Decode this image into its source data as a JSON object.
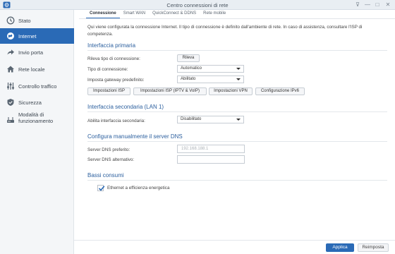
{
  "window": {
    "title": "Centro connessioni di rete"
  },
  "sidebar": {
    "items": [
      {
        "label": "Stato"
      },
      {
        "label": "Internet"
      },
      {
        "label": "Invio porta"
      },
      {
        "label": "Rete locale"
      },
      {
        "label": "Controllo traffico"
      },
      {
        "label": "Sicurezza"
      },
      {
        "label_line1": "Modalità di",
        "label_line2": "funzionamento"
      }
    ]
  },
  "tabs": [
    "Connessione",
    "Smart WAN",
    "QuickConnect & DDNS",
    "Rete mobile"
  ],
  "intro": "Qui viene configurata la connessione Internet. Il tipo di connessione è definito dall'ambiente di rete. In caso di assistenza, consultare l'ISP di competenza.",
  "primary": {
    "title": "Interfaccia primaria",
    "detect_label": "Rileva tipo di connessione:",
    "detect_button": "Rileva",
    "type_label": "Tipo di connessione:",
    "type_value": "Automatico",
    "gateway_label": "Imposta gateway predefinito:",
    "gateway_value": "Abilitato",
    "buttons": [
      "Impostazioni ISP",
      "Impostazioni ISP (IPTV & VoIP)",
      "Impostazioni VPN",
      "Configurazione IPv6"
    ]
  },
  "secondary": {
    "title": "Interfaccia secondaria (LAN 1)",
    "enable_label": "Abilita interfaccia secondaria:",
    "enable_value": "Disabilitato"
  },
  "dns": {
    "title": "Configura manualmente il server DNS",
    "preferred_label": "Server DNS preferito:",
    "preferred_placeholder": "192.168.188.1",
    "alternate_label": "Server DNS alternativo:",
    "alternate_placeholder": ""
  },
  "power": {
    "title": "Bassi consumi",
    "eee_label": "Ethernet a efficienza energetica",
    "eee_checked": true
  },
  "footer": {
    "apply": "Applica",
    "reset": "Reimposta"
  },
  "colors": {
    "accent": "#2a6ab6",
    "section_title": "#2b5f9e",
    "sidebar_bg": "#f4f6f8"
  }
}
